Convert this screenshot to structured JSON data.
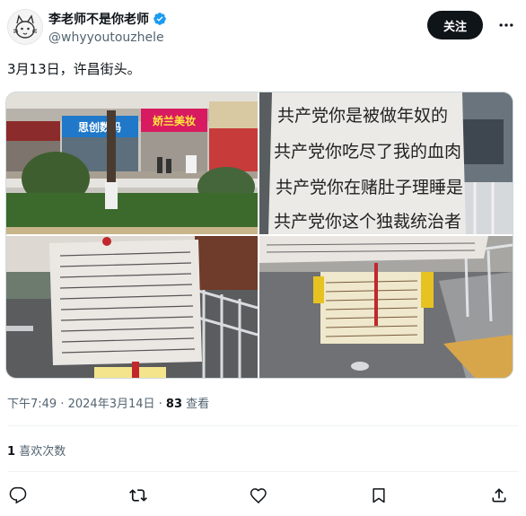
{
  "author": {
    "display_name": "李老师不是你老师",
    "handle": "@whyyoutouzhele",
    "verified": true
  },
  "follow_label": "关注",
  "more_icon": "more-horizontal-icon",
  "tweet_text": "3月13日，许昌街头。",
  "photos": [
    {
      "signs": [
        "思创数码",
        "娇兰美妆"
      ],
      "sign_colors": [
        "#1f78c8",
        "#d81b60"
      ]
    },
    {
      "banner_lines": [
        "共产党你是被做年奴的",
        "共产党你吃尽了我的血肉",
        "共产党你在赌肚子理睡是",
        "共产党你这个独裁统治者"
      ]
    },
    {},
    {}
  ],
  "timestamp": {
    "time": "下午7:49",
    "date": "2024年3月14日",
    "views_count": "83",
    "views_label": "查看"
  },
  "likes": {
    "count": "1",
    "label": "喜欢次数"
  },
  "actions": [
    "reply-icon",
    "retweet-icon",
    "like-icon",
    "bookmark-icon",
    "share-icon"
  ],
  "colors": {
    "verified": "#1d9bf0",
    "follow_bg": "#0f1419",
    "secondary_text": "#536471"
  }
}
